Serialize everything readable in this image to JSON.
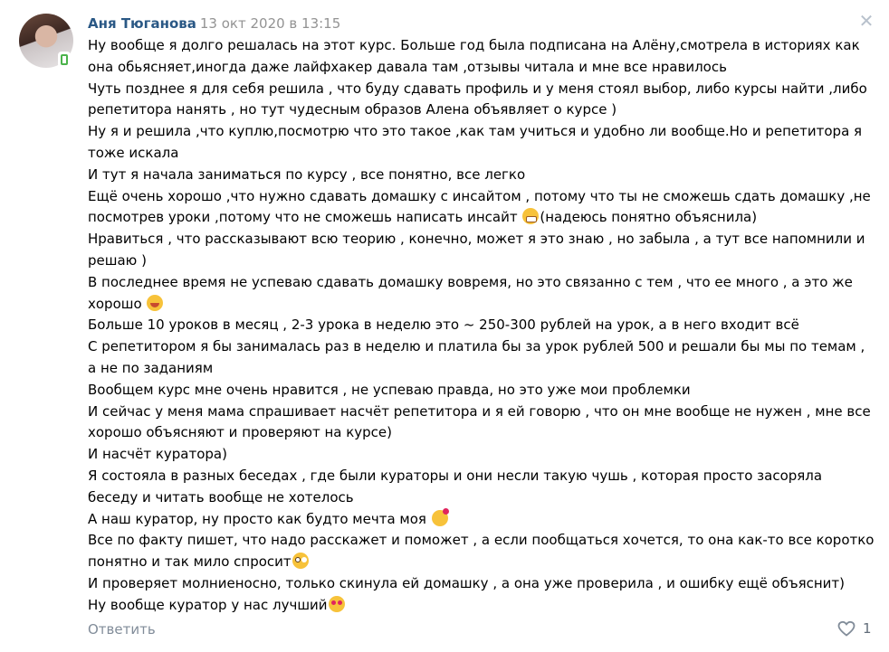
{
  "post": {
    "author": "Аня Тюганова",
    "date": "13 окт 2020 в 13:15",
    "close_icon": "close-icon",
    "lines": [
      "Ну вообще я долго решалась на этот курс. Больше год была подписана на Алёну,смотрела в историях как она обьясняет,иногда даже лайфхакер давала там ,отзывы читала и мне все нравилось",
      "Чуть позднее я для себя решила , что буду сдавать профиль и у меня стоял выбор, либо курсы найти ,либо репетитора нанять , но тут чудесным образов Алена объявляет о курсе )",
      "Ну я и решила ,что куплю,посмотрю что это такое ,как там учиться и удобно ли вообще.Но и репетитора я тоже искала",
      "И тут я начала заниматься по курсу , все понятно, все легко",
      "Ещё очень хорошо ,что нужно сдавать домашку с инсайтом , потому что ты не сможешь сдать домашку ,не посмотрев уроки ,потому что не сможешь написать инсайт",
      "(надеюсь понятно объяснила)",
      "Нравиться , что рассказывают всю теорию , конечно, может я это знаю , но забыла , а тут все напомнили и решаю )",
      "В последнее время не успеваю сдавать домашку вовремя, но это связанно с тем , что ее много , а это же хорошо",
      "Больше 10 уроков в месяц , 2-3 урока в неделю это ~ 250-300 рублей на урок, а в него входит всё",
      "С репетитором я бы занималась раз в неделю и платила бы за урок рублей 500 и решали бы мы по темам , а не по заданиям",
      "Вообщем курс мне очень нравится , не успеваю правда, но это уже мои проблемки",
      "И сейчас у меня мама спрашивает насчёт репетитора и я ей говорю , что он мне вообще не нужен , мне все хорошо объясняют и проверяют на курсе)",
      "И насчёт куратора)",
      "Я состояла в разных беседах , где были кураторы и они несли такую чушь , которая просто засоряла беседу и читать вообще не хотелось",
      "А наш куратор, ну просто как будто мечта моя",
      "Все по факту пишет, что надо расскажет и поможет , а если пообщаться хочется, то она как-то все коротко понятно и так мило спросит",
      "И проверяет молниеносно, только скинула ей домашку , а она уже проверила , и ошибку ещё объяснит)",
      "Ну вообще куратор у нас лучший"
    ],
    "emojis": {
      "grin": "grinning-face-icon",
      "laugh": "laughing-face-icon",
      "hearts": "smiling-face-with-hearts-icon",
      "flushed": "flushed-face-icon",
      "hearteyes": "heart-eyes-face-icon"
    },
    "reply_label": "Ответить",
    "like_icon": "heart-icon",
    "like_count": "1",
    "colors": {
      "author": "#2a5885",
      "meta": "#939393",
      "action": "#818c99"
    }
  }
}
